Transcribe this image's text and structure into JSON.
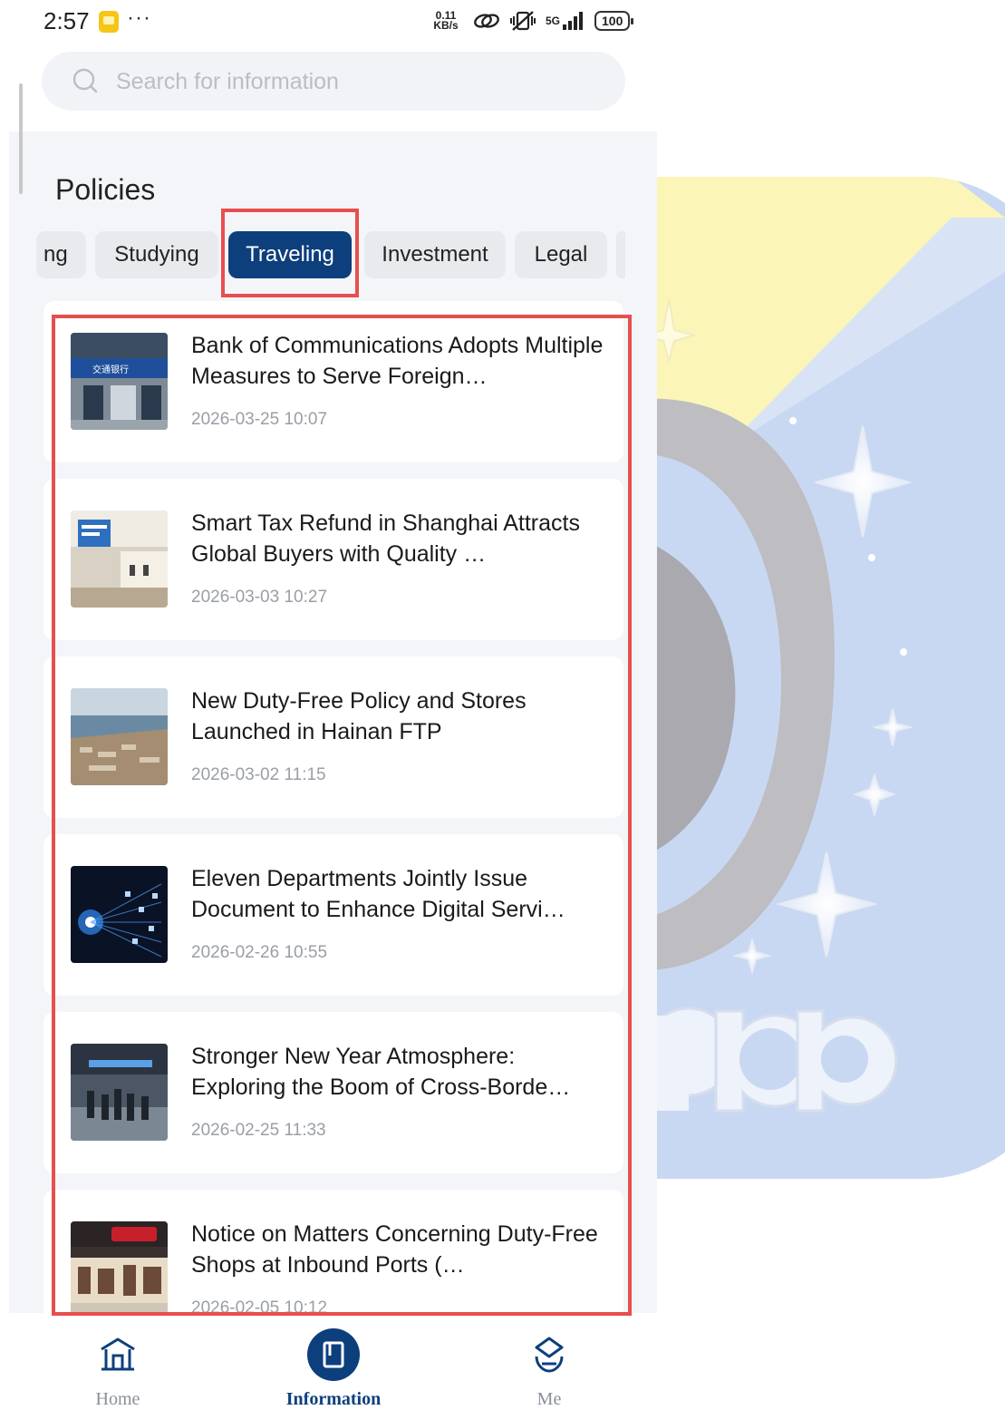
{
  "status_bar": {
    "time": "2:57",
    "dots": "···",
    "speed": "0.11 KB/s",
    "network": "5G",
    "battery": "100"
  },
  "search": {
    "placeholder": "Search for information"
  },
  "section_title": "Policies",
  "tabs": [
    {
      "label": "ng",
      "active": false
    },
    {
      "label": "Studying",
      "active": false
    },
    {
      "label": "Traveling",
      "active": true
    },
    {
      "label": "Investment",
      "active": false
    },
    {
      "label": "Legal",
      "active": false
    }
  ],
  "articles": [
    {
      "title": "Bank of Communications Adopts Multiple Measures to Serve Foreign…",
      "date": "2026-03-25 10:07",
      "thumb": "bank-storefront"
    },
    {
      "title": "Smart Tax Refund in Shanghai Attracts Global Buyers with Quality …",
      "date": "2026-03-03 10:27",
      "thumb": "tax-refund-counter"
    },
    {
      "title": "New Duty-Free Policy and Stores Launched in Hainan FTP",
      "date": "2026-03-02 11:15",
      "thumb": "port-aerial"
    },
    {
      "title": "Eleven Departments Jointly Issue Document to Enhance Digital Servi…",
      "date": "2026-02-26 10:55",
      "thumb": "digital-network"
    },
    {
      "title": "Stronger New Year Atmosphere: Exploring the Boom of Cross-Borde…",
      "date": "2026-02-25 11:33",
      "thumb": "station-crowd"
    },
    {
      "title": "Notice on Matters Concerning Duty-Free Shops at Inbound Ports (…",
      "date": "2026-02-05 10:12",
      "thumb": "duty-free-shop"
    }
  ],
  "nav": {
    "home": "Home",
    "information": "Information",
    "me": "Me"
  },
  "colors": {
    "accent": "#0d3f7d",
    "highlight": "#e84e4e",
    "panel_bg": "#f4f5f9"
  },
  "background_logo_text": "app"
}
